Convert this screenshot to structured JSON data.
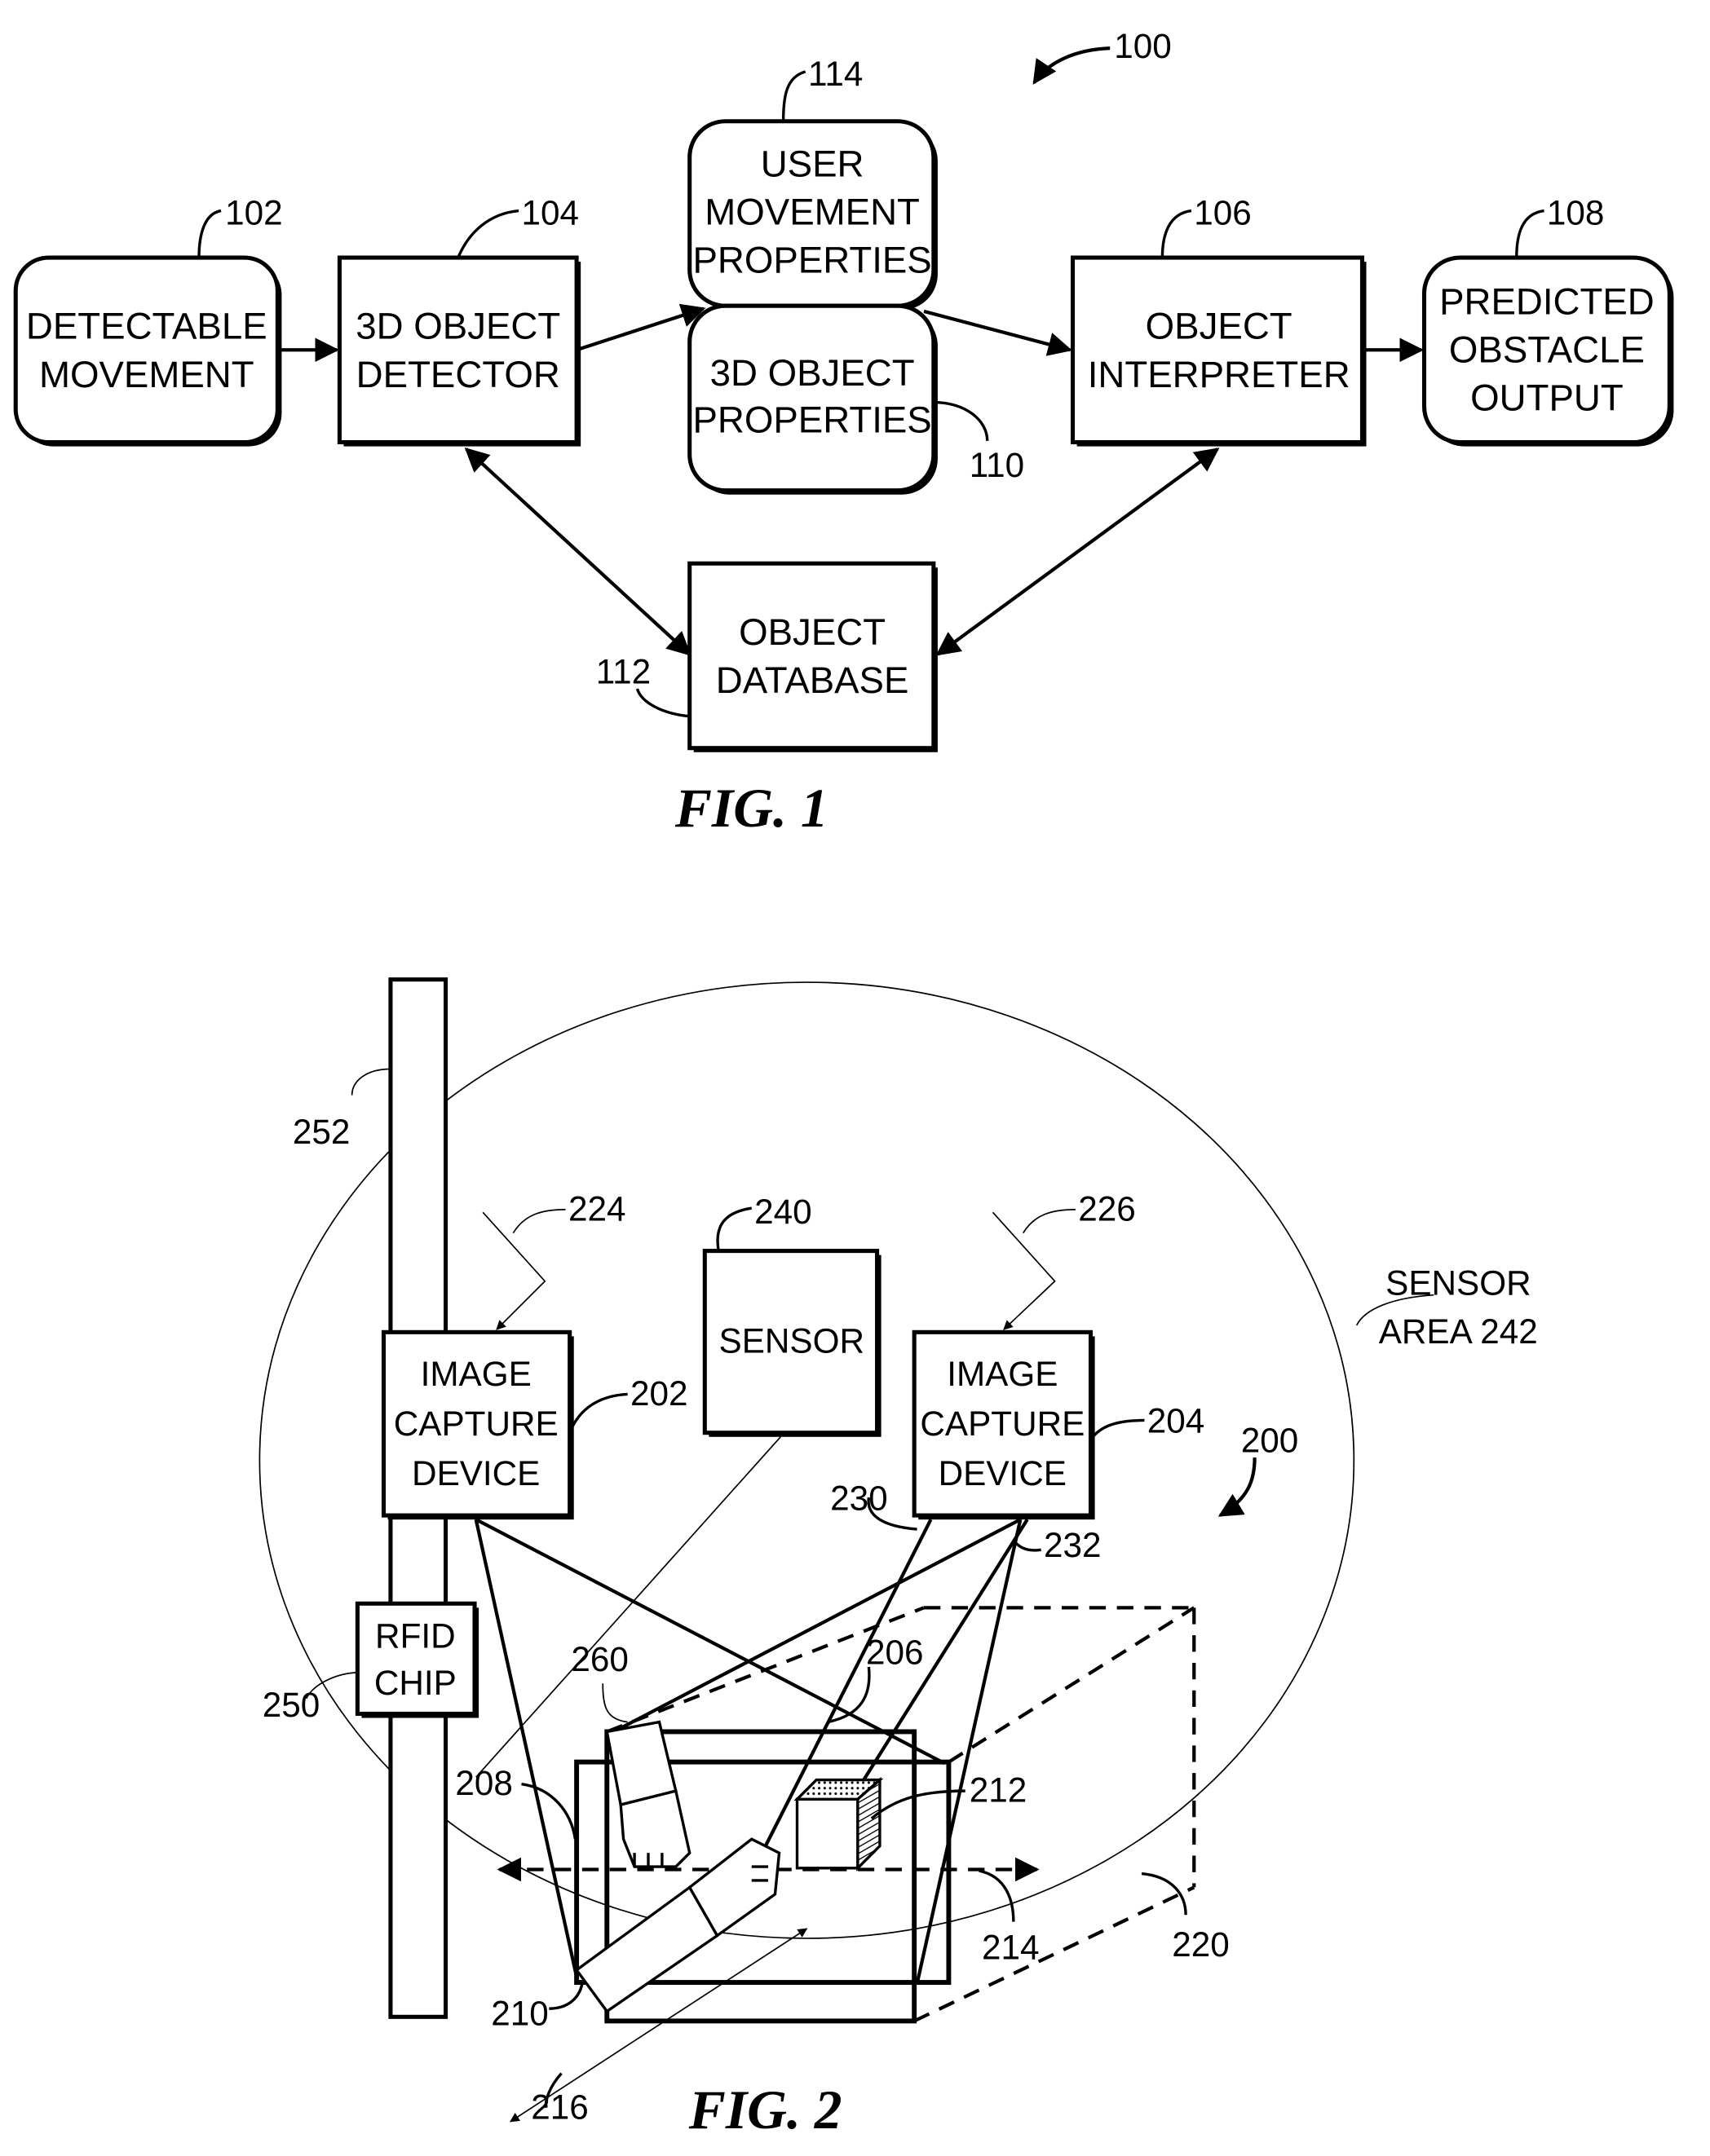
{
  "figure1": {
    "reference": "100",
    "caption": "FIG. 1",
    "blocks": {
      "detectable_movement": {
        "ref": "102",
        "lines": [
          "DETECTABLE",
          "MOVEMENT"
        ]
      },
      "object_detector": {
        "ref": "104",
        "lines": [
          "3D OBJECT",
          "DETECTOR"
        ]
      },
      "user_movement_properties": {
        "ref": "114",
        "lines": [
          "USER",
          "MOVEMENT",
          "PROPERTIES"
        ]
      },
      "object_properties": {
        "ref": "110",
        "lines": [
          "3D OBJECT",
          "PROPERTIES"
        ]
      },
      "object_interpreter": {
        "ref": "106",
        "lines": [
          "OBJECT",
          "INTERPRETER"
        ]
      },
      "predicted_obstacle_output": {
        "ref": "108",
        "lines": [
          "PREDICTED",
          "OBSTACLE",
          "OUTPUT"
        ]
      },
      "object_database": {
        "ref": "112",
        "lines": [
          "OBJECT",
          "DATABASE"
        ]
      }
    }
  },
  "figure2": {
    "reference": "200",
    "caption": "FIG. 2",
    "image_capture_left": {
      "ref": "202",
      "lines": [
        "IMAGE",
        "CAPTURE",
        "DEVICE"
      ],
      "signal_ref": "224"
    },
    "image_capture_right": {
      "ref": "204",
      "lines": [
        "IMAGE",
        "CAPTURE",
        "DEVICE"
      ],
      "signal_ref": "226"
    },
    "sensor": {
      "ref": "240",
      "label": "SENSOR"
    },
    "sensor_area": {
      "lines": [
        "SENSOR",
        "AREA 242"
      ]
    },
    "rfid_chip": {
      "ref": "250",
      "lines": [
        "RFID",
        "CHIP"
      ]
    },
    "pole_ref": "252",
    "refs": {
      "detectable_area": "206",
      "plane_208": "208",
      "arm_210": "210",
      "object_212": "212",
      "axis_214": "214",
      "axis_216": "216",
      "volume_220": "220",
      "line_230": "230",
      "line_232": "232",
      "hand_260": "260"
    }
  }
}
